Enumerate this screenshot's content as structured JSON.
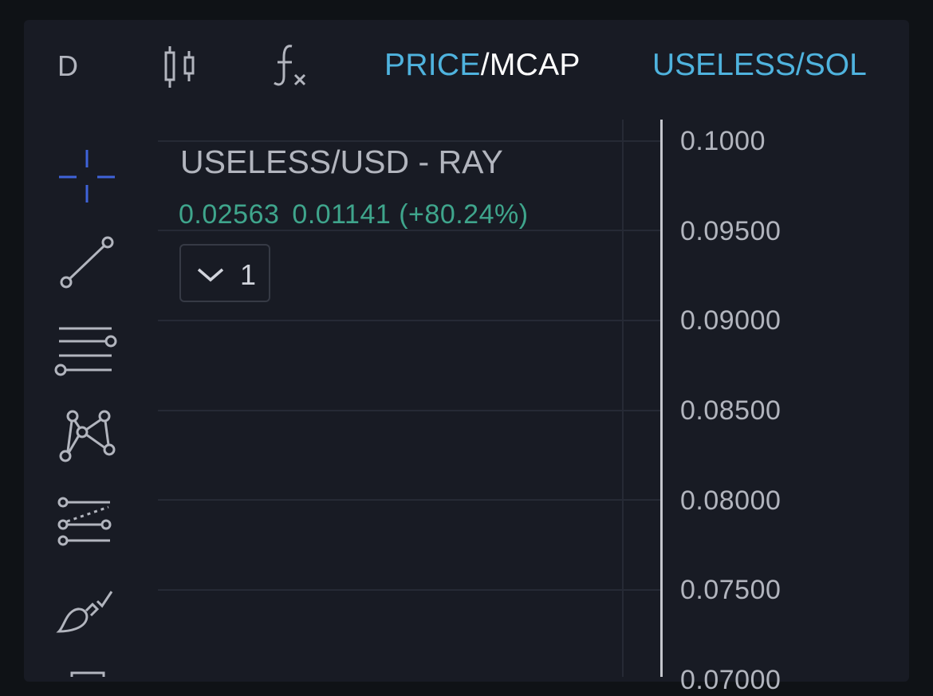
{
  "toolbar": {
    "interval": "D",
    "price_toggle": {
      "active": "PRICE",
      "separator": "/",
      "inactive": "MCAP"
    },
    "pair": "USELESS/SOL",
    "icons": [
      "candlestick-icon",
      "fx-indicator-icon"
    ]
  },
  "left_tools": [
    {
      "name": "crosshair-icon"
    },
    {
      "name": "trendline-icon"
    },
    {
      "name": "fib-retracement-icon"
    },
    {
      "name": "pattern-icon"
    },
    {
      "name": "forecast-icon"
    },
    {
      "name": "brush-icon"
    }
  ],
  "legend": {
    "title": "USELESS/USD - RAY",
    "price": "0.02563",
    "change": "0.01141 (+80.24%)",
    "indicator_count": "1"
  },
  "price_axis": {
    "labels": [
      "0.1000",
      "0.09500",
      "0.09000",
      "0.08500",
      "0.08000",
      "0.07500",
      "0.07000"
    ]
  },
  "colors": {
    "background": "#181b24",
    "accent": "#4fb3de",
    "positive": "#3fa58c",
    "crosshair": "#3f63d9"
  }
}
